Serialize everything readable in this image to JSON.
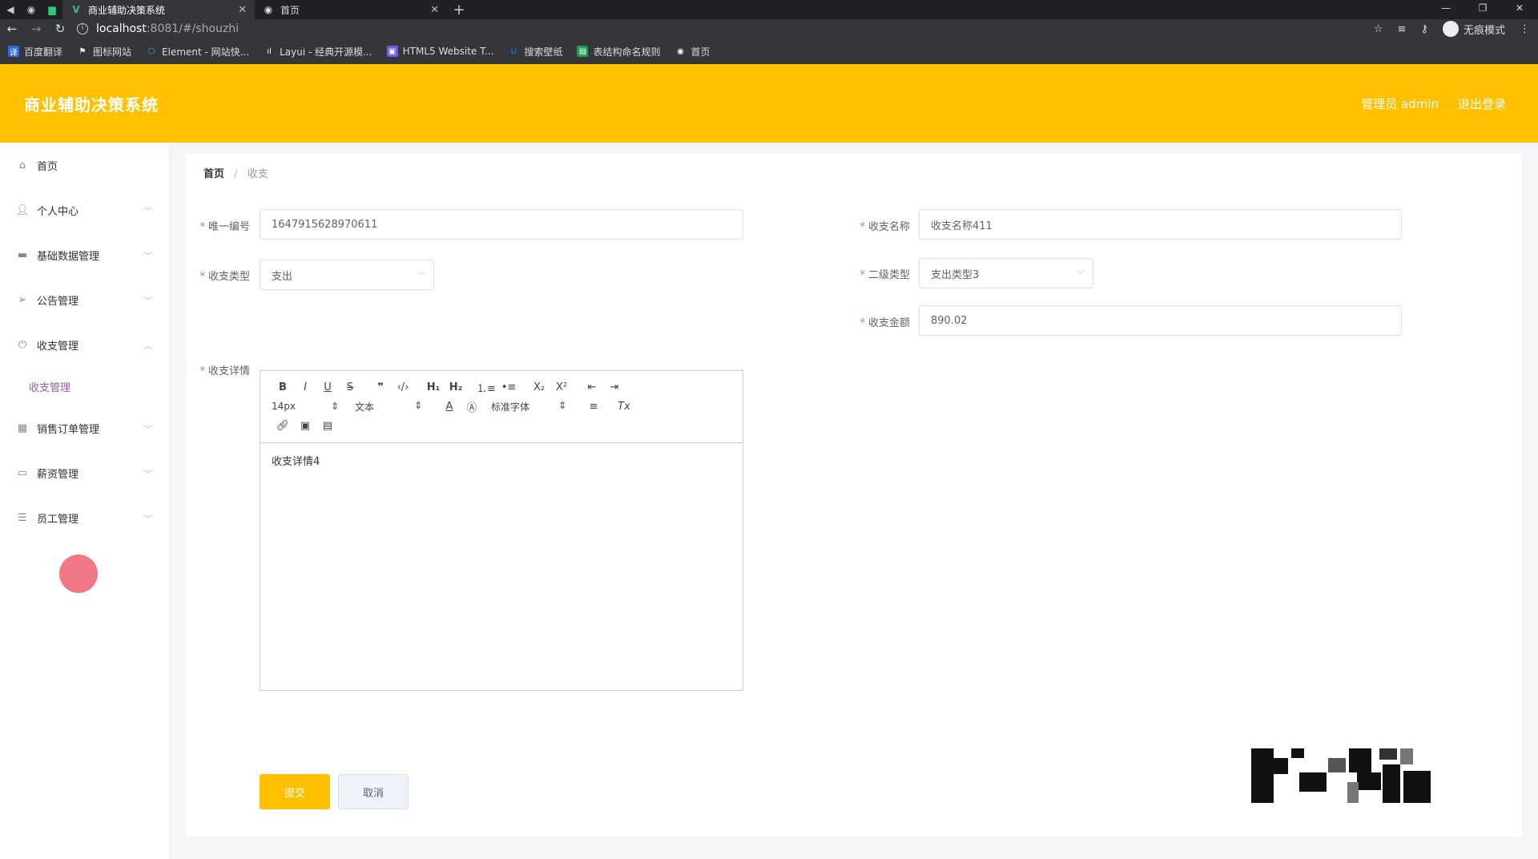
{
  "browser": {
    "tabs": [
      {
        "title": "商业辅助决策系统",
        "active": true,
        "icon": "vue-icon"
      },
      {
        "title": "首页",
        "active": false,
        "icon": "globe-icon"
      }
    ],
    "url_host": "localhost",
    "url_path": ":8081/#/shouzhi",
    "profile_label": "无痕模式",
    "bookmarks": [
      "百度翻译",
      "图标网站",
      "Element - 网站快...",
      "Layui - 经典开源模...",
      "HTML5 Website T...",
      "搜索壁纸",
      "表结构命名规则",
      "首页"
    ]
  },
  "header": {
    "title": "商业辅助决策系统",
    "user": "管理员 admin",
    "logout": "退出登录"
  },
  "sidebar": {
    "items": [
      {
        "label": "首页",
        "icon": "home-icon"
      },
      {
        "label": "个人中心",
        "icon": "user-icon"
      },
      {
        "label": "基础数据管理",
        "icon": "monitor-icon"
      },
      {
        "label": "公告管理",
        "icon": "send-icon"
      },
      {
        "label": "收支管理",
        "icon": "power-icon"
      },
      {
        "label": "销售订单管理",
        "icon": "grid-icon"
      },
      {
        "label": "薪资管理",
        "icon": "card-icon"
      },
      {
        "label": "员工管理",
        "icon": "list-icon"
      }
    ],
    "submenu_active": "收支管理"
  },
  "breadcrumb": {
    "home": "首页",
    "current": "收支"
  },
  "form": {
    "unique_id_label": "唯一编号",
    "unique_id_value": "1647915628970611",
    "name_label": "收支名称",
    "name_value": "收支名称411",
    "type_label": "收支类型",
    "type_value": "支出",
    "subtype_label": "二级类型",
    "subtype_value": "支出类型3",
    "amount_label": "收支金额",
    "amount_value": "890.02",
    "detail_label": "收支详情",
    "detail_value": "收支详情4",
    "submit": "提交",
    "cancel": "取消"
  },
  "editor": {
    "font_size": "14px",
    "heading": "文本",
    "font_family": "标准字体"
  }
}
